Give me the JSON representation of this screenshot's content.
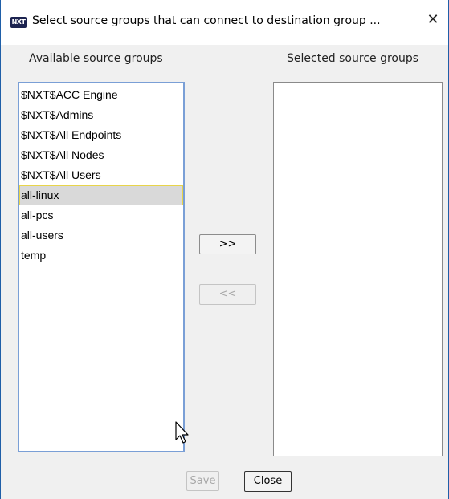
{
  "window": {
    "app_icon_text": "NXT",
    "title": "Select source groups that can connect to destination group ..."
  },
  "labels": {
    "available": "Available source groups",
    "selected": "Selected source groups"
  },
  "available_groups": [
    "$NXT$ACC Engine",
    "$NXT$Admins",
    "$NXT$All Endpoints",
    "$NXT$All Nodes",
    "$NXT$All Users",
    "all-linux",
    "all-pcs",
    "all-users",
    "temp"
  ],
  "highlighted_group": "all-linux",
  "selected_groups": [],
  "buttons": {
    "add": ">>",
    "remove": "<<",
    "save": "Save",
    "close": "Close"
  },
  "colors": {
    "highlight_bg": "#d9d9d9",
    "highlight_border": "#e8d44a",
    "focus_border": "#7a9fd6",
    "icon_bg": "#1c2350"
  }
}
